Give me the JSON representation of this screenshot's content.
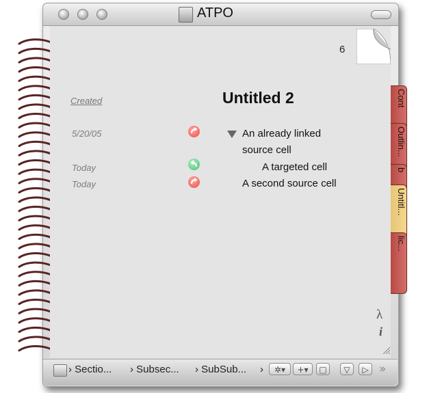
{
  "window": {
    "title": "ATPO"
  },
  "page": {
    "number": "6"
  },
  "document": {
    "created_label": "Created",
    "title": "Untitled 2",
    "entries": [
      {
        "date": "5/20/05",
        "lines": [
          "An already linked",
          "source cell"
        ],
        "link": "source",
        "color": "#e9514a"
      },
      {
        "date": "Today",
        "lines": [
          "A targeted cell"
        ],
        "link": "target",
        "color": "#3fbe6a"
      },
      {
        "date": "Today",
        "lines": [
          "A second source cell"
        ],
        "link": "source",
        "color": "#e9514a"
      }
    ]
  },
  "tabs": [
    {
      "label": "Cont",
      "state": "inactive"
    },
    {
      "label": "Outlin...",
      "state": "inactive"
    },
    {
      "label": "b",
      "state": "inactive"
    },
    {
      "label": "Untitl...",
      "state": "active"
    },
    {
      "label": "lic...",
      "state": "inactive"
    }
  ],
  "side_icons": {
    "lambda": "λ",
    "info": "i"
  },
  "breadcrumb": [
    "› Sectio...",
    "› Subsec...",
    "› SubSub...",
    "›"
  ],
  "toolbar": {
    "gear": "✲▾",
    "add": "+▾",
    "box": "□",
    "down": "▽",
    "play": "▷",
    "more": "»"
  },
  "colors": {
    "tab_red": "#c4504b",
    "tab_active": "#eccd82",
    "link_red": "#e9514a",
    "link_green": "#3fbe6a"
  }
}
